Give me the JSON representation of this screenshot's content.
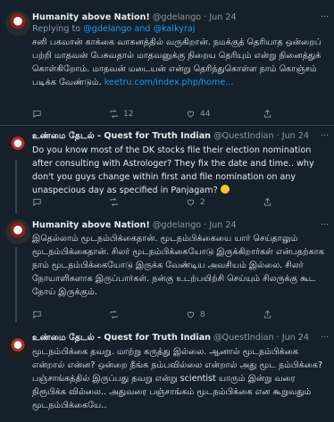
{
  "tweets": [
    {
      "name": "Humanity above Nation!",
      "handle": "@gdelango · Jun 24",
      "replying_prefix": "Replying to",
      "replying_to": "@gdelango and @kalkyraj",
      "body": "சனி பகவான் காக்கை வாகனத்தில் வருகிறான். நமக்குத் தெரியாத ஒன்றைப் பற்றி மாதவன் பேசுவதால் மாதவனுக்கு நிறைய தெரியும் என்று நினைத்துக் கொள்கிறோம். மாதவன் மடையன் என்று தெரிந்துகொள்ள நாம் கொஞ்சம் படிக்க வேண்டும். ",
      "link": "keetru.com/index.php/home...",
      "reply_count": "",
      "retweet_count": "12",
      "like_count": "44"
    },
    {
      "name": "உண்மை தேடல் - Quest for Truth Indian",
      "handle": "@QuestIndian · Jun 24",
      "body": "Do you know most of the DK stocks file their election nomination after consulting with Astrologer? They fix the date and time.. why don't you guys change within first and file nomination on any unaspecious day as specified in Panjagam? ",
      "reply_count": "",
      "retweet_count": "",
      "like_count": "2"
    },
    {
      "name": "Humanity above Nation!",
      "handle": "@gdelango · Jun 24",
      "body": "இதெல்லாம் மூடநம்பிக்கைதான். மூடநம்பிக்கையை யார் செய்தாலும் மூடநம்பிக்கைதான். சிலர் மூடநம்பிக்கையோடு இருக்கிறார்கள் என்பதற்காக நாம் மூடநம்பிக்கையோடு இருக்க வேண்டிய அவசியம் இல்லை. சிலர் நோயாளிகளாக இருப்பார்கள். நன்கு உடற்பயிற்சி செய்யும் சிலருக்கு கூட நோய் இருக்கும்.",
      "reply_count": "",
      "retweet_count": "",
      "like_count": "8"
    },
    {
      "name": "உண்மை தேடல் - Quest for Truth Indian",
      "handle": "@QuestIndian · Jun 24",
      "body": "மூடநம்பிக்கை தவறு. மாற்று கருத்து இல்லை. ஆனால் மூடநம்பிக்கை என்றால் என்ன? ஒன்றை நீங்க நம்பவில்லை என்றால் அது மூட நம்பிக்கை? பஞ்சாங்கத்தில் இருப்பது தவறு என்று scientist யாரும் இன்று வரை நிரூபிக்க வில்லை.. அதுவரை பஞ்சாங்கம் மூடநம்பிக்கை என கூறுவதும் மூடநம்பிக்கையே.."
    }
  ],
  "icons": {
    "reply": "reply-icon",
    "retweet": "retweet-icon",
    "like": "heart-icon",
    "share": "share-icon",
    "more": "more-icon"
  },
  "colors": {
    "background": "#15202b",
    "link": "#1d9bf0",
    "muted": "#8b98a5"
  }
}
